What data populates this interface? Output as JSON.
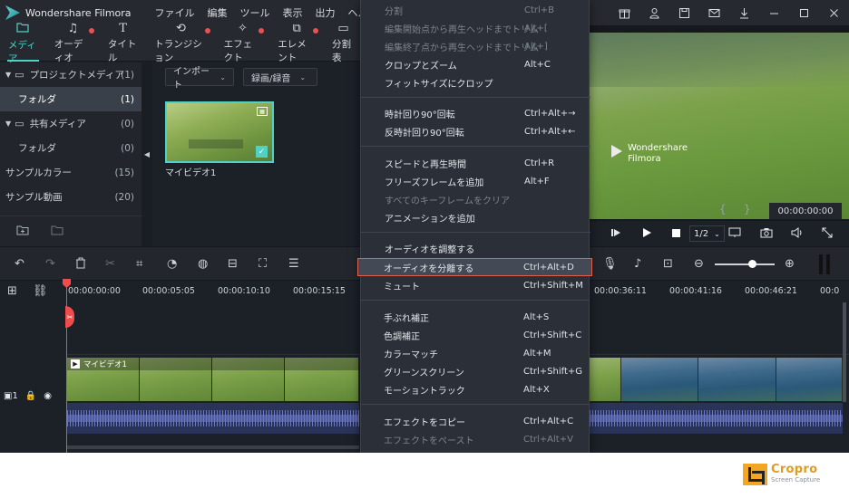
{
  "app": {
    "title": "Wondershare Filmora"
  },
  "menubar": [
    "ファイル",
    "編集",
    "ツール",
    "表示",
    "出力",
    "ヘルプ"
  ],
  "tabs": [
    {
      "label": "メディア",
      "icon": "folder-icon",
      "active": true,
      "dot": false
    },
    {
      "label": "オーディオ",
      "icon": "music-note-icon",
      "active": false,
      "dot": true
    },
    {
      "label": "タイトル",
      "icon": "text-icon",
      "active": false,
      "dot": false
    },
    {
      "label": "トランジション",
      "icon": "transition-icon",
      "active": false,
      "dot": true
    },
    {
      "label": "エフェクト",
      "icon": "effect-icon",
      "active": false,
      "dot": true
    },
    {
      "label": "エレメント",
      "icon": "element-icon",
      "active": false,
      "dot": true
    },
    {
      "label": "分割表",
      "icon": "split-screen-icon",
      "active": false,
      "dot": false
    }
  ],
  "sidebar": {
    "items": [
      {
        "label": "プロジェクトメディア",
        "count": "(1)"
      },
      {
        "label": "フォルダ",
        "count": "(1)"
      },
      {
        "label": "共有メディア",
        "count": "(0)"
      },
      {
        "label": "フォルダ",
        "count": "(0)"
      },
      {
        "label": "サンプルカラー",
        "count": "(15)"
      },
      {
        "label": "サンプル動画",
        "count": "(20)"
      }
    ]
  },
  "media": {
    "import_label": "インポート",
    "record_label": "録画/録音",
    "thumb_label": "マイビデオ1"
  },
  "preview": {
    "timecode": "00:00:00:00",
    "ratio": "1/2",
    "watermark_line1": "Wondershare",
    "watermark_line2": "Filmora"
  },
  "ruler": [
    "00:00:00:00",
    "00:00:05:05",
    "00:00:10:10",
    "00:00:15:15",
    "00:00:36:11",
    "00:00:41:16",
    "00:00:46:21",
    "00:0"
  ],
  "track": {
    "label": "1",
    "clip_name": "マイビデオ1"
  },
  "context_menu": [
    {
      "label": "分割",
      "shortcut": "Ctrl+B",
      "disabled": true
    },
    {
      "label": "編集開始点から再生ヘッドまでトリム",
      "shortcut": "Alt+[",
      "disabled": true
    },
    {
      "label": "編集終了点から再生ヘッドまでトリム",
      "shortcut": "Alt+]",
      "disabled": true
    },
    {
      "label": "クロップとズーム",
      "shortcut": "Alt+C",
      "disabled": false
    },
    {
      "label": "フィットサイズにクロップ",
      "shortcut": "",
      "disabled": false
    },
    {
      "label": "時計回り90°回転",
      "shortcut": "Ctrl+Alt+→",
      "disabled": false
    },
    {
      "label": "反時計回り90°回転",
      "shortcut": "Ctrl+Alt+←",
      "disabled": false
    },
    {
      "label": "スピードと再生時間",
      "shortcut": "Ctrl+R",
      "disabled": false
    },
    {
      "label": "フリーズフレームを追加",
      "shortcut": "Alt+F",
      "disabled": false
    },
    {
      "label": "すべてのキーフレームをクリア",
      "shortcut": "",
      "disabled": true
    },
    {
      "label": "アニメーションを追加",
      "shortcut": "",
      "disabled": false
    },
    {
      "label": "オーディオを調整する",
      "shortcut": "",
      "disabled": false
    },
    {
      "label": "オーディオを分離する",
      "shortcut": "Ctrl+Alt+D",
      "disabled": false
    },
    {
      "label": "ミュート",
      "shortcut": "Ctrl+Shift+M",
      "disabled": false
    },
    {
      "label": "手ぶれ補正",
      "shortcut": "Alt+S",
      "disabled": false
    },
    {
      "label": "色調補正",
      "shortcut": "Ctrl+Shift+C",
      "disabled": false
    },
    {
      "label": "カラーマッチ",
      "shortcut": "Alt+M",
      "disabled": false
    },
    {
      "label": "グリーンスクリーン",
      "shortcut": "Ctrl+Shift+G",
      "disabled": false
    },
    {
      "label": "モーショントラック",
      "shortcut": "Alt+X",
      "disabled": false
    },
    {
      "label": "エフェクトをコピー",
      "shortcut": "Ctrl+Alt+C",
      "disabled": false
    },
    {
      "label": "エフェクトをペースト",
      "shortcut": "Ctrl+Alt+V",
      "disabled": true
    }
  ],
  "badge": {
    "name": "Cropro",
    "sub": "Screen Capture"
  }
}
